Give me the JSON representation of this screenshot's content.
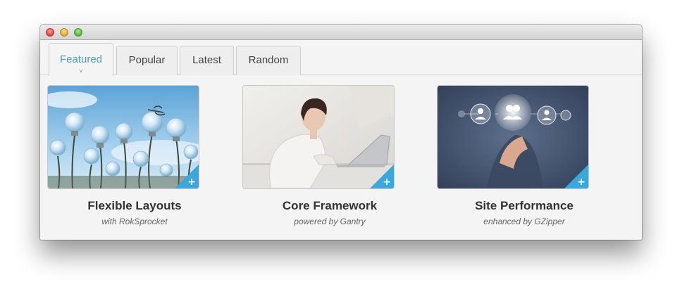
{
  "window": {
    "buttons": [
      "close",
      "minimize",
      "zoom"
    ]
  },
  "tabs": [
    {
      "label": "Featured",
      "active": true,
      "indicator": "˅"
    },
    {
      "label": "Popular",
      "active": false
    },
    {
      "label": "Latest",
      "active": false
    },
    {
      "label": "Random",
      "active": false
    }
  ],
  "cards": [
    {
      "title": "Flexible Layouts",
      "subtitle": "with RokSprocket",
      "image": "lightbulbs-photo",
      "corner_icon": "+"
    },
    {
      "title": "Core Framework",
      "subtitle": "powered by Gantry",
      "image": "woman-laptop-photo",
      "corner_icon": "+"
    },
    {
      "title": "Site Performance",
      "subtitle": "enhanced by GZipper",
      "image": "touch-network-photo",
      "corner_icon": "+"
    }
  ],
  "colors": {
    "accent": "#4a9fc9",
    "corner": "#3aa8dc",
    "window_bg": "#f4f4f4"
  }
}
